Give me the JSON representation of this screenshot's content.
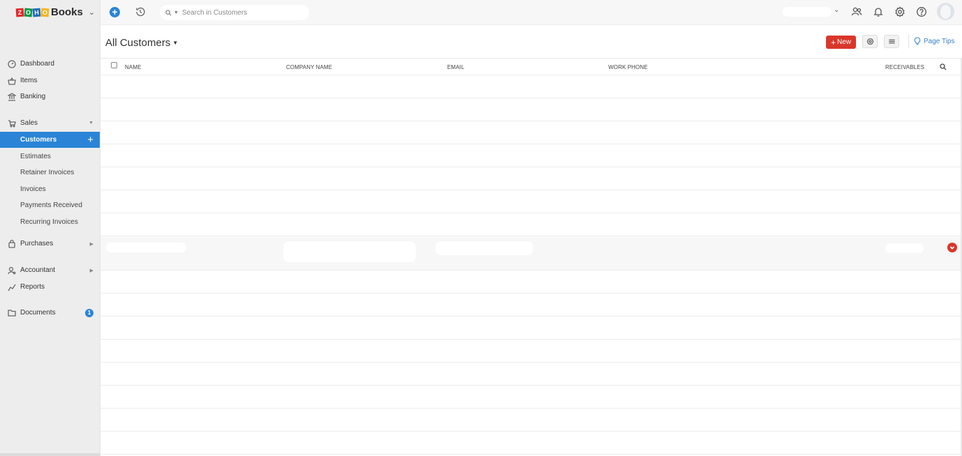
{
  "brand": {
    "name": "Books",
    "logo_letters": [
      "Z",
      "O",
      "H",
      "O"
    ]
  },
  "topbar": {
    "search_placeholder": "Search in Customers",
    "icons": [
      "add-icon",
      "history-icon",
      "search-icon",
      "users-icon",
      "bell-icon",
      "gear-icon",
      "help-icon",
      "avatar"
    ]
  },
  "sidebar": {
    "items": [
      {
        "label": "Dashboard",
        "icon": "dashboard-icon"
      },
      {
        "label": "Items",
        "icon": "basket-icon"
      },
      {
        "label": "Banking",
        "icon": "bank-icon"
      },
      {
        "label": "Sales",
        "icon": "cart-icon",
        "expanded": true
      },
      {
        "label": "Customers",
        "active": true
      },
      {
        "label": "Estimates"
      },
      {
        "label": "Retainer Invoices"
      },
      {
        "label": "Invoices"
      },
      {
        "label": "Payments Received"
      },
      {
        "label": "Recurring Invoices"
      },
      {
        "label": "Purchases",
        "icon": "bag-icon"
      },
      {
        "label": "Accountant",
        "icon": "accountant-icon"
      },
      {
        "label": "Reports",
        "icon": "reports-icon"
      },
      {
        "label": "Documents",
        "icon": "folder-icon",
        "badge": "1"
      }
    ]
  },
  "header": {
    "title": "All Customers",
    "new_label": "New",
    "page_tips_label": "Page Tips"
  },
  "table": {
    "columns": [
      "NAME",
      "COMPANY NAME",
      "EMAIL",
      "WORK PHONE",
      "RECEIVABLES"
    ],
    "rows": [
      {
        "name": "",
        "company": "",
        "email": "",
        "phone": "",
        "receivables": ""
      },
      {
        "name": "",
        "company": "",
        "email": "",
        "phone": "",
        "receivables": ""
      },
      {
        "name": "",
        "company": "",
        "email": "",
        "phone": "",
        "receivables": ""
      },
      {
        "name": "",
        "company": "",
        "email": "",
        "phone": "",
        "receivables": ""
      },
      {
        "name": "",
        "company": "",
        "email": "",
        "phone": "",
        "receivables": ""
      },
      {
        "name": "",
        "company": "",
        "email": "",
        "phone": "",
        "receivables": ""
      },
      {
        "name": "",
        "company": "",
        "email": "",
        "phone": "",
        "receivables": ""
      },
      {
        "name": "",
        "company": "",
        "email": "",
        "phone": "",
        "receivables": "",
        "highlighted": true
      },
      {
        "name": "",
        "company": "",
        "email": "",
        "phone": "",
        "receivables": ""
      },
      {
        "name": "",
        "company": "",
        "email": "",
        "phone": "",
        "receivables": ""
      },
      {
        "name": "",
        "company": "",
        "email": "",
        "phone": "",
        "receivables": ""
      },
      {
        "name": "",
        "company": "",
        "email": "",
        "phone": "",
        "receivables": ""
      },
      {
        "name": "",
        "company": "",
        "email": "",
        "phone": "",
        "receivables": ""
      },
      {
        "name": "",
        "company": "",
        "email": "",
        "phone": "",
        "receivables": ""
      },
      {
        "name": "",
        "company": "",
        "email": "",
        "phone": "",
        "receivables": ""
      },
      {
        "name": "",
        "company": "",
        "email": "",
        "phone": "",
        "receivables": ""
      }
    ]
  },
  "colors": {
    "accent_blue": "#2b84d6",
    "new_button_red": "#d9372a",
    "sidebar_bg": "#ededed"
  }
}
